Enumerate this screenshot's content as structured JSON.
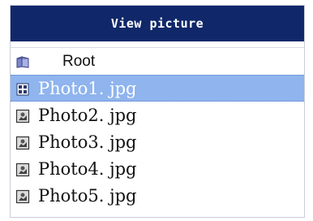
{
  "window": {
    "title": "View picture"
  },
  "tree": {
    "root": {
      "label": "Root",
      "icon": "folder-icon"
    },
    "items": [
      {
        "label": "Photo1. jpg",
        "icon": "image-file-icon",
        "selected": true
      },
      {
        "label": "Photo2. jpg",
        "icon": "image-file-icon",
        "selected": false
      },
      {
        "label": "Photo3. jpg",
        "icon": "image-file-icon",
        "selected": false
      },
      {
        "label": "Photo4. jpg",
        "icon": "image-file-icon",
        "selected": false
      },
      {
        "label": "Photo5. jpg",
        "icon": "image-file-icon",
        "selected": false
      }
    ]
  },
  "colors": {
    "titlebar": "#10286a",
    "selection": "#8fb4ee"
  }
}
